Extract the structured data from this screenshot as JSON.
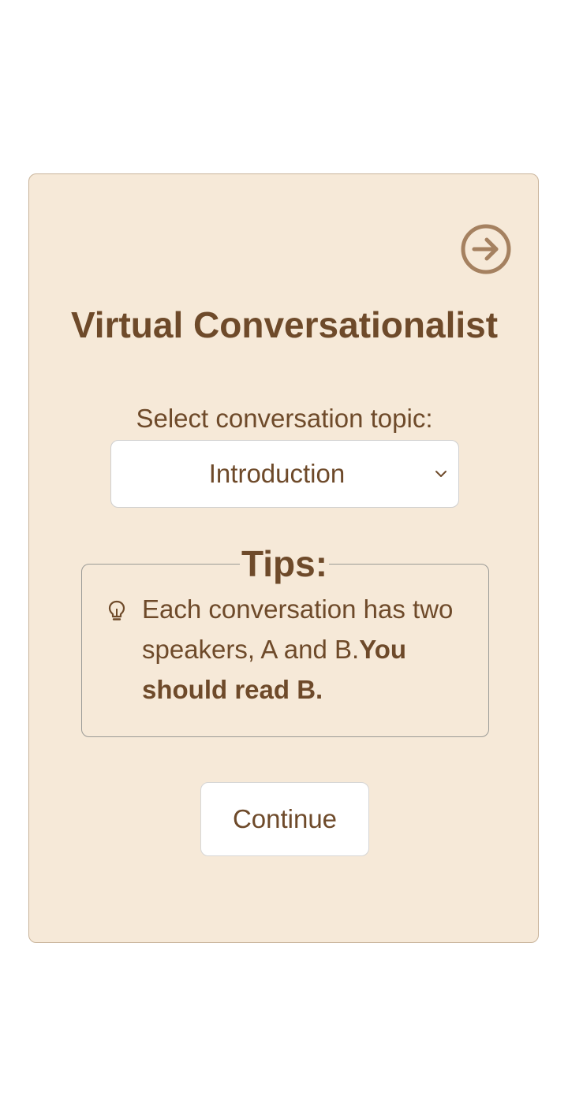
{
  "card": {
    "title": "Virtual Conversationalist",
    "forward_icon": "arrow-right-circle-icon"
  },
  "topic": {
    "label": "Select conversation topic:",
    "selected": "Introduction"
  },
  "tips": {
    "heading": "Tips:",
    "icon": "lightbulb-icon",
    "text": "Each conversation has two speakers, A and B.",
    "emphasis": "You should read B."
  },
  "actions": {
    "continue_label": "Continue"
  },
  "colors": {
    "card_bg": "#f6e9d8",
    "text_brown": "#6e4a2a",
    "icon_brown": "#a58160"
  }
}
